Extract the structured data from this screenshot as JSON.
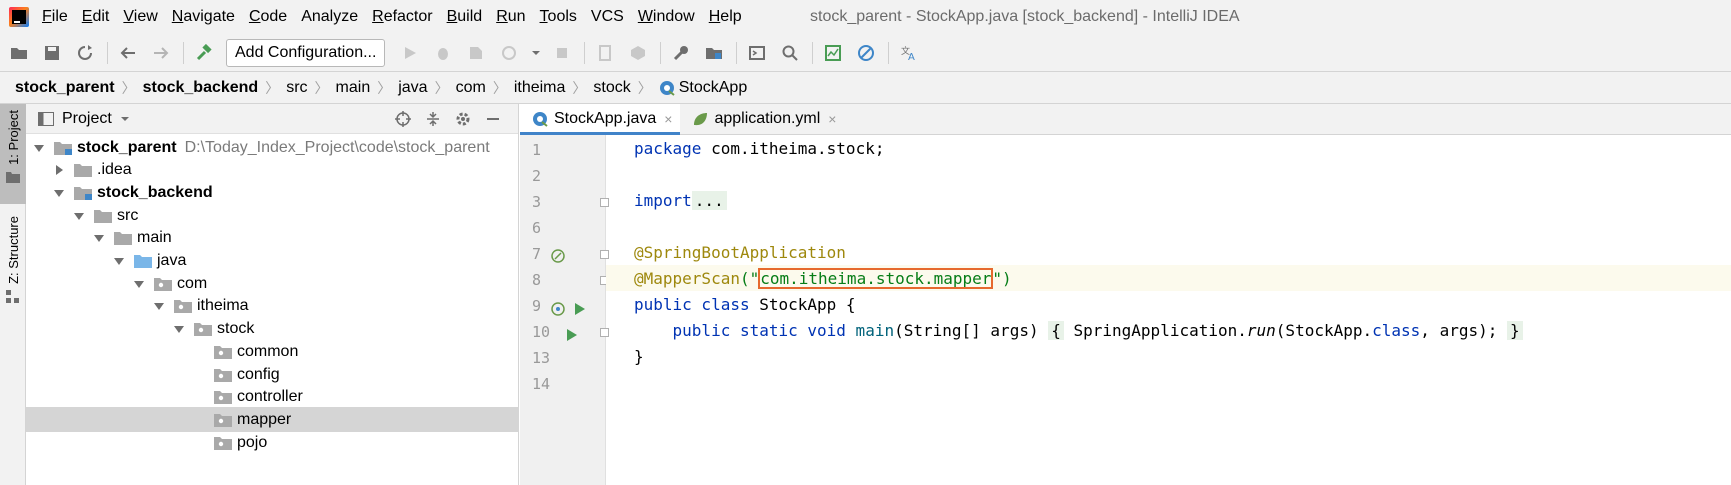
{
  "menubar": {
    "items": [
      {
        "label": "File",
        "mnemonic": "F",
        "rest": "ile"
      },
      {
        "label": "Edit",
        "mnemonic": "E",
        "rest": "dit"
      },
      {
        "label": "View",
        "mnemonic": "V",
        "rest": "iew"
      },
      {
        "label": "Navigate",
        "mnemonic": "N",
        "rest": "avigate"
      },
      {
        "label": "Code",
        "mnemonic": "C",
        "rest": "ode"
      },
      {
        "label": "Analyze",
        "mnemonic": "",
        "rest": "Analyze"
      },
      {
        "label": "Refactor",
        "mnemonic": "R",
        "rest": "efactor"
      },
      {
        "label": "Build",
        "mnemonic": "B",
        "rest": "uild"
      },
      {
        "label": "Run",
        "mnemonic": "R",
        "rest": "un"
      },
      {
        "label": "Tools",
        "mnemonic": "T",
        "rest": "ools"
      },
      {
        "label": "VCS",
        "mnemonic": "",
        "rest": "VCS"
      },
      {
        "label": "Window",
        "mnemonic": "W",
        "rest": "indow"
      },
      {
        "label": "Help",
        "mnemonic": "H",
        "rest": "elp"
      }
    ],
    "window_title": "stock_parent - StockApp.java [stock_backend] - IntelliJ IDEA"
  },
  "toolbar": {
    "add_configuration": "Add Configuration..."
  },
  "breadcrumb": {
    "items": [
      "stock_parent",
      "stock_backend",
      "src",
      "main",
      "java",
      "com",
      "itheima",
      "stock",
      "StockApp"
    ]
  },
  "side_strip": {
    "project": "1: Project",
    "structure": "Z: Structure"
  },
  "project_panel": {
    "title": "Project",
    "tree": [
      {
        "label": "stock_parent",
        "hint": "D:\\Today_Index_Project\\code\\stock_parent",
        "bold": true
      },
      {
        "label": ".idea",
        "hint": ""
      },
      {
        "label": "stock_backend",
        "hint": "",
        "bold": true
      },
      {
        "label": "src",
        "hint": ""
      },
      {
        "label": "main",
        "hint": ""
      },
      {
        "label": "java",
        "hint": ""
      },
      {
        "label": "com",
        "hint": ""
      },
      {
        "label": "itheima",
        "hint": ""
      },
      {
        "label": "stock",
        "hint": ""
      },
      {
        "label": "common",
        "hint": ""
      },
      {
        "label": "config",
        "hint": ""
      },
      {
        "label": "controller",
        "hint": ""
      },
      {
        "label": "mapper",
        "hint": ""
      },
      {
        "label": "pojo",
        "hint": ""
      }
    ]
  },
  "editor": {
    "tabs": [
      {
        "label": "StockApp.java",
        "close": "×"
      },
      {
        "label": "application.yml",
        "close": "×"
      }
    ],
    "line_numbers": [
      "1",
      "2",
      "3",
      "6",
      "7",
      "8",
      "9",
      "10",
      "13",
      "14"
    ],
    "code": {
      "l1_kw": "package",
      "l1_rest": " com.itheima.stock;",
      "l3_kw": "import",
      "l3_fold": "...",
      "l7_ann": "@SpringBootApplication",
      "l8_ann": "@MapperScan",
      "l8_open": "(\"",
      "l8_str": "com.itheima.stock.mapper",
      "l8_close": "\")",
      "l9_kw": "public class",
      "l9_rest": " StockApp {",
      "l10_indent": "    ",
      "l10_kw": "public static void",
      "l10_fn": " main",
      "l10_args": "(String[] args) ",
      "l10_body_open": "{",
      "l10_body_a": " SpringApplication.",
      "l10_run": "run",
      "l10_body_b": "(StockApp.",
      "l10_class": "class",
      "l10_body_c": ", args); ",
      "l10_body_close": "}",
      "l13": "}"
    }
  },
  "colors": {
    "accent": "#4083c9",
    "keyword": "#0033b3",
    "annotation": "#9e880d",
    "string": "#067d17",
    "highlight_border": "#e6692e"
  }
}
